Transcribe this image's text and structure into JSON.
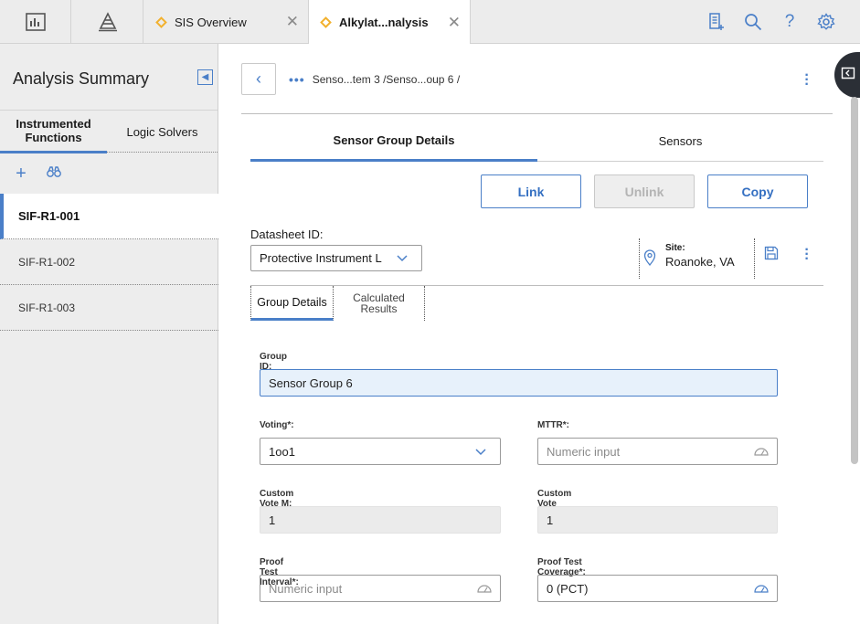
{
  "tabs": {
    "sis_overview": "SIS Overview",
    "analysis": "Alkylat...nalysis"
  },
  "left_panel": {
    "title": "Analysis Summary",
    "tab_functions": "Instrumented Functions",
    "tab_solvers": "Logic Solvers",
    "items": [
      "SIF-R1-001",
      "SIF-R1-002",
      "SIF-R1-003"
    ]
  },
  "breadcrumb": "Senso...tem 3 /Senso...oup 6 /",
  "main_tabs": {
    "details": "Sensor Group Details",
    "sensors": "Sensors"
  },
  "buttons": {
    "link": "Link",
    "unlink": "Unlink",
    "copy": "Copy"
  },
  "datasheet": {
    "label": "Datasheet ID:",
    "value": "Protective Instrument Loop"
  },
  "site": {
    "label": "Site:",
    "value": "Roanoke, VA"
  },
  "sub_tabs": {
    "group_details": "Group Details",
    "calculated_results_1": "Calculated",
    "calculated_results_2": "Results"
  },
  "form": {
    "group_id_label": "Group ID:",
    "group_id_value": "Sensor Group 6",
    "voting_label": "Voting*:",
    "voting_value": "1oo1",
    "mttr_label": "MTTR*:",
    "mttr_placeholder": "Numeric input",
    "custom_m_label": "Custom Vote M:",
    "custom_m_value": "1",
    "custom_n_label": "Custom Vote N*:",
    "custom_n_value": "1",
    "proof_interval_label": "Proof Test Interval*:",
    "proof_interval_placeholder": "Numeric input",
    "proof_coverage_label": "Proof Test Coverage*:",
    "proof_coverage_value": "0 (PCT)"
  },
  "colors": {
    "accent": "#4a7fc8",
    "tab_diamond": "#f2b12e"
  }
}
